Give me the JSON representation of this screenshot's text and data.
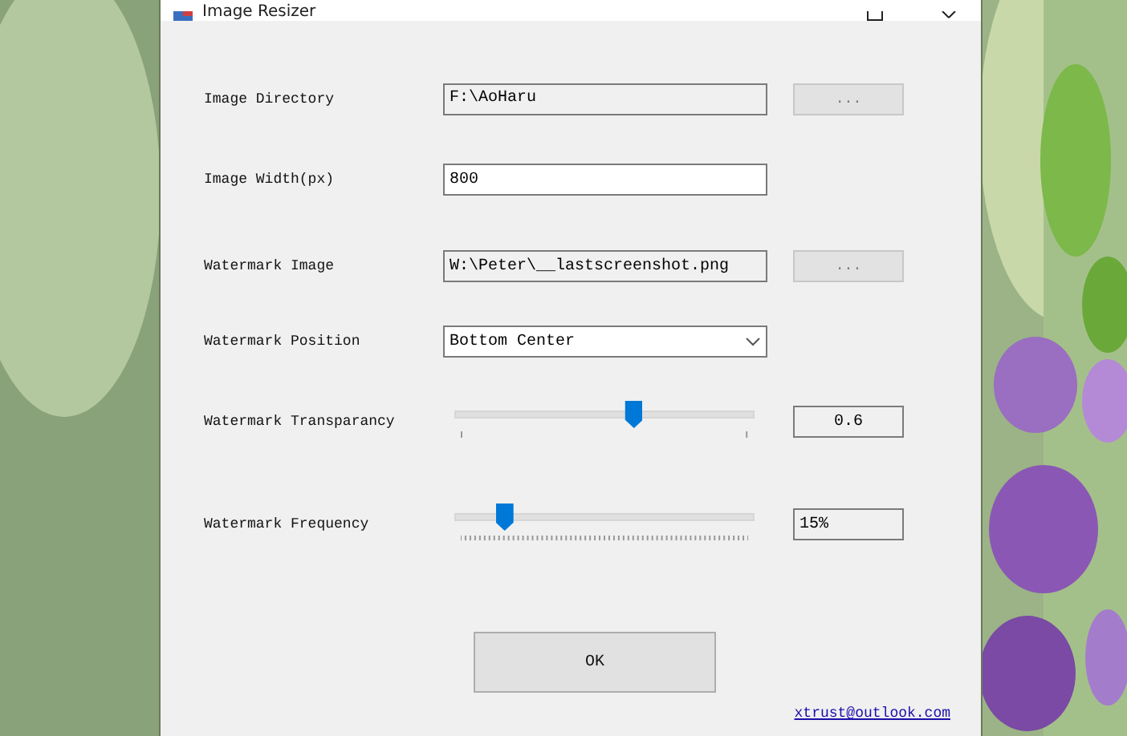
{
  "window": {
    "title": "Image Resizer"
  },
  "fields": [
    {
      "kind": "path",
      "label": "Image Directory",
      "value": "F:\\AoHaru",
      "button": "..."
    },
    {
      "kind": "text",
      "label": "Image Width(px)",
      "value": "800"
    },
    {
      "kind": "path",
      "label": "Watermark Image",
      "value": "W:\\Peter\\__lastscreenshot.png",
      "button": "..."
    },
    {
      "kind": "dropdown",
      "label": "Watermark Position",
      "value": "Bottom Center"
    },
    {
      "kind": "slider",
      "label": "Watermark Transparancy",
      "level": 0.6,
      "reading": "0.6"
    },
    {
      "kind": "ticked-slider",
      "label": "Watermark Frequency",
      "level": 0.15,
      "reading": "15%"
    }
  ],
  "ok_button": "OK",
  "link": "xtrust@outlook.com"
}
